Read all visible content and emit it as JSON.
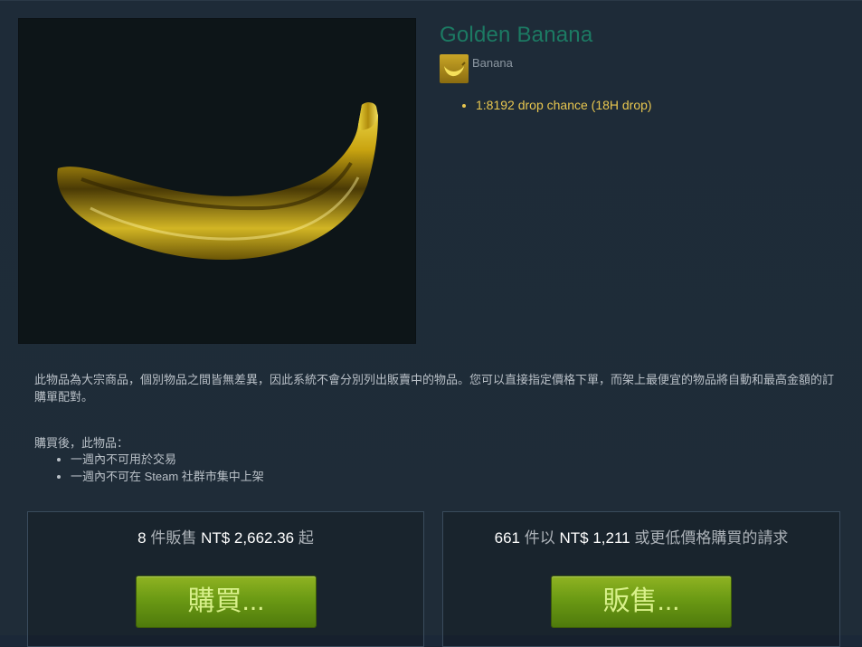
{
  "item": {
    "title": "Golden Banana",
    "game_name": "Banana",
    "game_icon": "banana-game-icon",
    "descriptions": [
      "1:8192 drop chance (18H drop)"
    ],
    "image": "golden-banana-image"
  },
  "notes": {
    "commodity": "此物品為大宗商品，個別物品之間皆無差異，因此系統不會分別列出販賣中的物品。您可以直接指定價格下單，而架上最便宜的物品將自動和最高金額的訂購單配對。",
    "after_purchase_heading": "購買後，此物品：",
    "restrictions": [
      "一週內不可用於交易",
      "一週內不可在 Steam 社群市集中上架"
    ]
  },
  "buy_box": {
    "count": "8",
    "count_suffix": "件販售",
    "price": "NT$ 2,662.36",
    "price_suffix": "起",
    "button_label": "購買..."
  },
  "sell_box": {
    "count": "661",
    "count_suffix": "件以",
    "price": "NT$ 1,211",
    "price_suffix": "或更低價格購買的請求",
    "button_label": "販售..."
  },
  "colors": {
    "background": "#1b2838",
    "title": "#1c7a63",
    "description": "#e8c64f",
    "button_green": "#6b9a14"
  }
}
